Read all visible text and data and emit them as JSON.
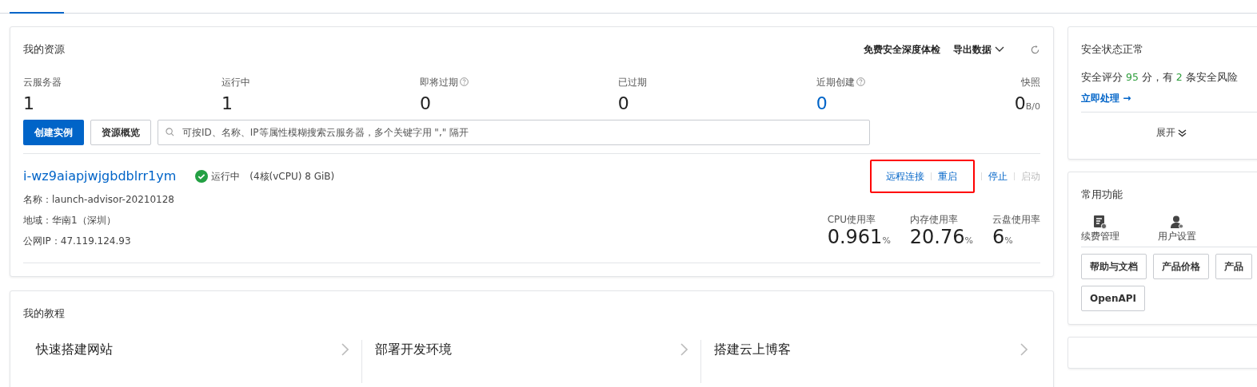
{
  "resources": {
    "title": "我的资源",
    "header_links": [
      {
        "label": "免费安全深度体检",
        "kind": "link"
      },
      {
        "label": "导出数据",
        "kind": "dropdown"
      },
      {
        "kind": "refresh"
      }
    ],
    "stats": [
      {
        "label": "云服务器",
        "value": "1",
        "help": false,
        "highlight": false
      },
      {
        "label": "运行中",
        "value": "1",
        "help": false,
        "highlight": false
      },
      {
        "label": "即将过期",
        "value": "0",
        "help": true,
        "highlight": false
      },
      {
        "label": "已过期",
        "value": "0",
        "help": false,
        "highlight": false
      },
      {
        "label": "近期创建",
        "value": "0",
        "help": true,
        "highlight": true
      },
      {
        "label": "快照",
        "value": "0",
        "unit": "B/0",
        "help": false,
        "highlight": false
      }
    ],
    "buttons": [
      {
        "label": "创建实例",
        "primary": true
      },
      {
        "label": "资源概览",
        "primary": false
      }
    ],
    "search": {
      "placeholder": "可按ID、名称、IP等属性模糊搜索云服务器，多个关键字用 \",\" 隔开"
    },
    "instance": {
      "id": "i-wz9aiapjwjgbdblrr1ym",
      "status": "运行中",
      "spec": "(4核(vCPU) 8 GiB)",
      "details": [
        "名称：launch-advisor-20210128",
        "地域：华南1（深圳）",
        "公网IP：47.119.124.93"
      ],
      "actions": [
        {
          "label": "远程连接",
          "disabled": false,
          "highlighted": true
        },
        {
          "label": "重启",
          "disabled": false,
          "highlighted": true
        },
        {
          "label": "停止",
          "disabled": false,
          "highlighted": false
        },
        {
          "label": "启动",
          "disabled": true,
          "highlighted": false
        }
      ],
      "metrics": [
        {
          "label": "CPU使用率",
          "value": "0.961",
          "unit": "%"
        },
        {
          "label": "内存使用率",
          "value": "20.76",
          "unit": "%"
        },
        {
          "label": "云盘使用率",
          "value": "6",
          "unit": "%"
        }
      ]
    }
  },
  "tutorials": {
    "title": "我的教程",
    "items": [
      {
        "title": "快速搭建网站"
      },
      {
        "title": "部署开发环境"
      },
      {
        "title": "搭建云上博客"
      }
    ]
  },
  "security": {
    "title": "安全状态正常",
    "summary": [
      {
        "text": "安全评分 ",
        "kind": "text"
      },
      {
        "text": "95",
        "kind": "number"
      },
      {
        "text": " 分，有 ",
        "kind": "text"
      },
      {
        "text": "2",
        "kind": "number"
      },
      {
        "text": " 条安全风险",
        "kind": "text"
      }
    ],
    "action": "立即处理 →",
    "expand": "展开"
  },
  "functions": {
    "title": "常用功能",
    "shortcuts": [
      {
        "label": "续费管理",
        "kind": "bill"
      },
      {
        "label": "用户设置",
        "kind": "user"
      }
    ],
    "buttons": [
      "帮助与文档",
      "产品价格",
      "产品",
      "OpenAPI"
    ]
  }
}
